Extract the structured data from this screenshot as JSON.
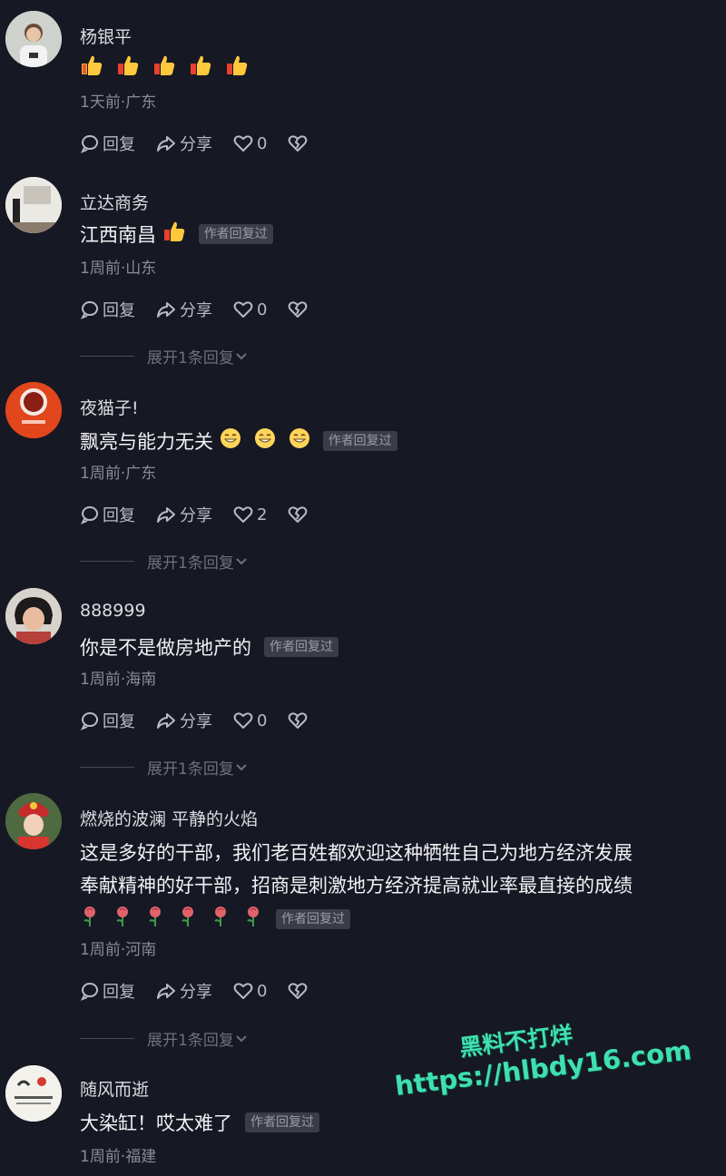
{
  "actions": {
    "reply": "回复",
    "share": "分享"
  },
  "expand_label": "展开1条回复",
  "author_badge": "作者回复过",
  "comments": [
    {
      "name": "杨银平",
      "text": "",
      "emoji": "thumbs-up x5",
      "meta": "1天前·广东",
      "likes": "0"
    },
    {
      "name": "立达商务",
      "text": "江西南昌",
      "emoji": "thumbs-up",
      "meta": "1周前·山东",
      "likes": "0"
    },
    {
      "name": "夜猫子!",
      "text": "飘亮与能力无关",
      "emoji": "grin x3",
      "meta": "1周前·广东",
      "likes": "2"
    },
    {
      "name": "888999",
      "text": "你是不是做房地产的",
      "meta": "1周前·海南",
      "likes": "0"
    },
    {
      "name": "燃烧的波澜 平静的火焰",
      "text_line1": "这是多好的干部，我们老百姓都欢迎这种牺牲自己为地方经济发展",
      "text_line2": "奉献精神的好干部，招商是刺激地方经济提高就业率最直接的成绩",
      "emoji": "rose x6",
      "meta": "1周前·河南",
      "likes": "0"
    },
    {
      "name": "随风而逝",
      "text": "大染缸！哎太难了",
      "meta": "1周前·福建"
    }
  ],
  "watermark": {
    "line1": "黑料不打烊",
    "line2": "https://hlbdy16.com"
  },
  "colors": {
    "background": "#161823",
    "watermark": "#3fe0b0",
    "badge_bg": "#3a3c48"
  }
}
